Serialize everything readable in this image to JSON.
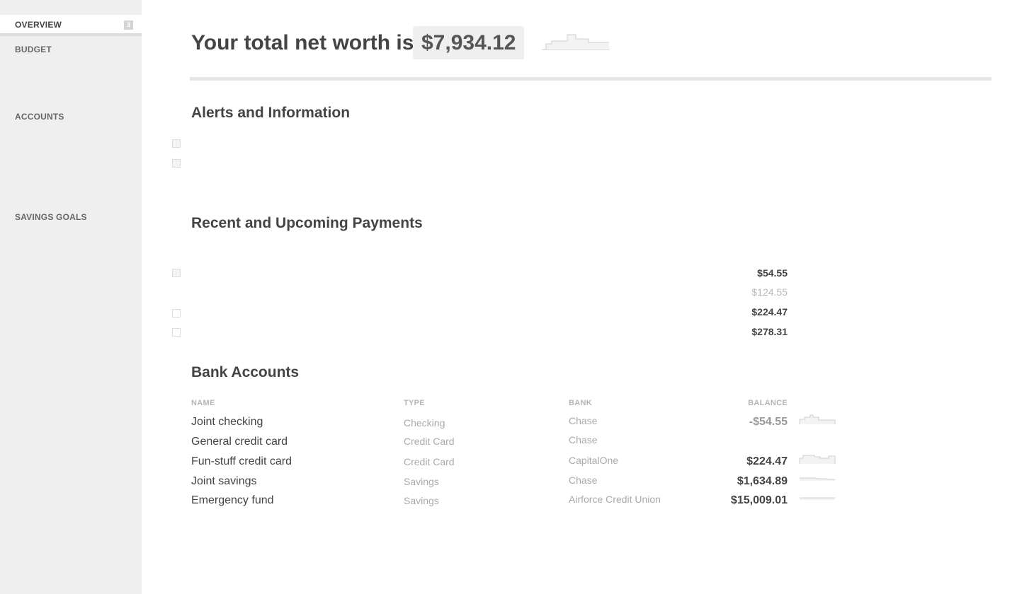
{
  "sidebar": {
    "items": [
      {
        "label": "OVERVIEW",
        "badge": "3",
        "active": true
      },
      {
        "label": "BUDGET"
      },
      {
        "label": "ACCOUNTS"
      },
      {
        "label": "SAVINGS GOALS"
      }
    ]
  },
  "networth": {
    "title": "Your total net worth is",
    "value": "$7,934.12"
  },
  "alerts": {
    "title": "Alerts and Information"
  },
  "payments": {
    "title": "Recent and Upcoming Payments",
    "items": [
      {
        "amount": "$54.55"
      },
      {
        "amount": "$124.55"
      },
      {
        "amount": "$224.47"
      },
      {
        "amount": "$278.31"
      }
    ]
  },
  "bank_accounts": {
    "title": "Bank Accounts",
    "headers": {
      "name": "NAME",
      "type": "TYPE",
      "bank": "BANK",
      "balance": "BALANCE"
    },
    "rows": [
      {
        "name": "Joint checking",
        "type": "Checking",
        "bank": "Chase",
        "balance": "-$54.55"
      },
      {
        "name": "General credit card",
        "type": "Credit Card",
        "bank": "Chase",
        "balance": ""
      },
      {
        "name": "Fun-stuff credit card",
        "type": "Credit Card",
        "bank": "CapitalOne",
        "balance": "$224.47"
      },
      {
        "name": "Joint savings",
        "type": "Savings",
        "bank": "Chase",
        "balance": "$1,634.89"
      },
      {
        "name": "Emergency fund",
        "type": "Savings",
        "bank": "Airforce Credit Union",
        "balance": "$15,009.01"
      }
    ]
  },
  "colors": {
    "sidebar_bg": "#efefef",
    "text": "#444444",
    "muted": "#aaaaaa"
  }
}
